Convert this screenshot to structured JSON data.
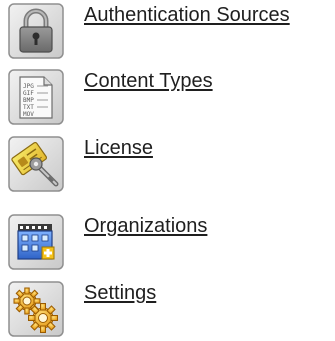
{
  "admin_menu": {
    "items": [
      {
        "label": "Authentication Sources",
        "icon": "padlock-icon"
      },
      {
        "label": "Content Types",
        "icon": "document-types-icon"
      },
      {
        "label": "License",
        "icon": "license-key-icon"
      },
      {
        "label": "Organizations",
        "icon": "organization-building-icon"
      },
      {
        "label": "Settings",
        "icon": "settings-gears-icon"
      }
    ]
  }
}
